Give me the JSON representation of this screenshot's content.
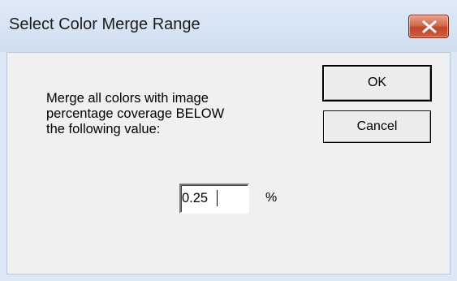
{
  "window": {
    "title": "Select Color Merge Range"
  },
  "dialog": {
    "message_lines": [
      "Merge all colors with image",
      "percentage coverage BELOW",
      "the following value:"
    ],
    "ok_label": "OK",
    "cancel_label": "Cancel",
    "value": "0.25",
    "unit": "%"
  },
  "icons": {
    "close": "close-icon"
  },
  "colors": {
    "close_button": "#c9543a",
    "titlebar": "#d7e4f3",
    "client_background": "#f0f0f0"
  }
}
